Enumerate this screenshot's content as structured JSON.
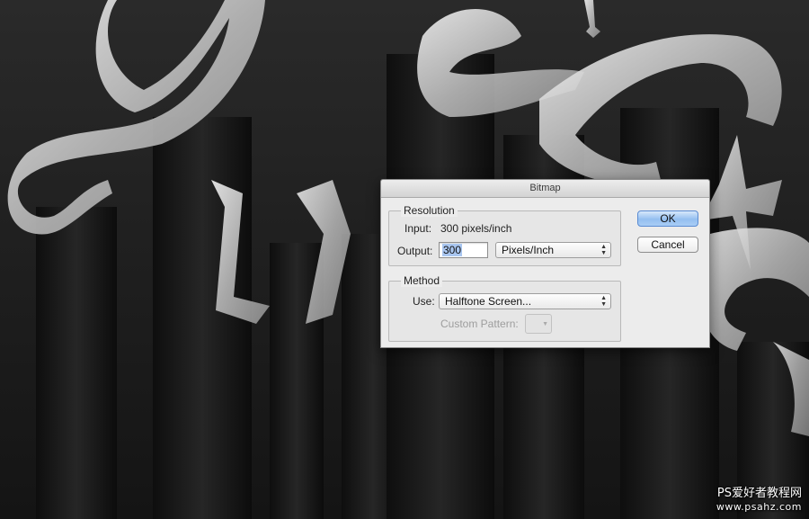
{
  "dialog": {
    "title": "Bitmap",
    "resolution": {
      "group_title": "Resolution",
      "input_label": "Input:",
      "input_value": "300 pixels/inch",
      "output_label": "Output:",
      "output_value": "300",
      "unit_selected": "Pixels/Inch"
    },
    "method": {
      "group_title": "Method",
      "use_label": "Use:",
      "use_selected": "Halftone Screen...",
      "custom_pattern_label": "Custom Pattern:"
    },
    "buttons": {
      "ok": "OK",
      "cancel": "Cancel"
    }
  },
  "watermark": {
    "line1": "PS爱好者教程网",
    "line2": "www.psahz.com"
  },
  "colors": {
    "default_button": "#94bff0",
    "background": "#1c1c1c"
  }
}
